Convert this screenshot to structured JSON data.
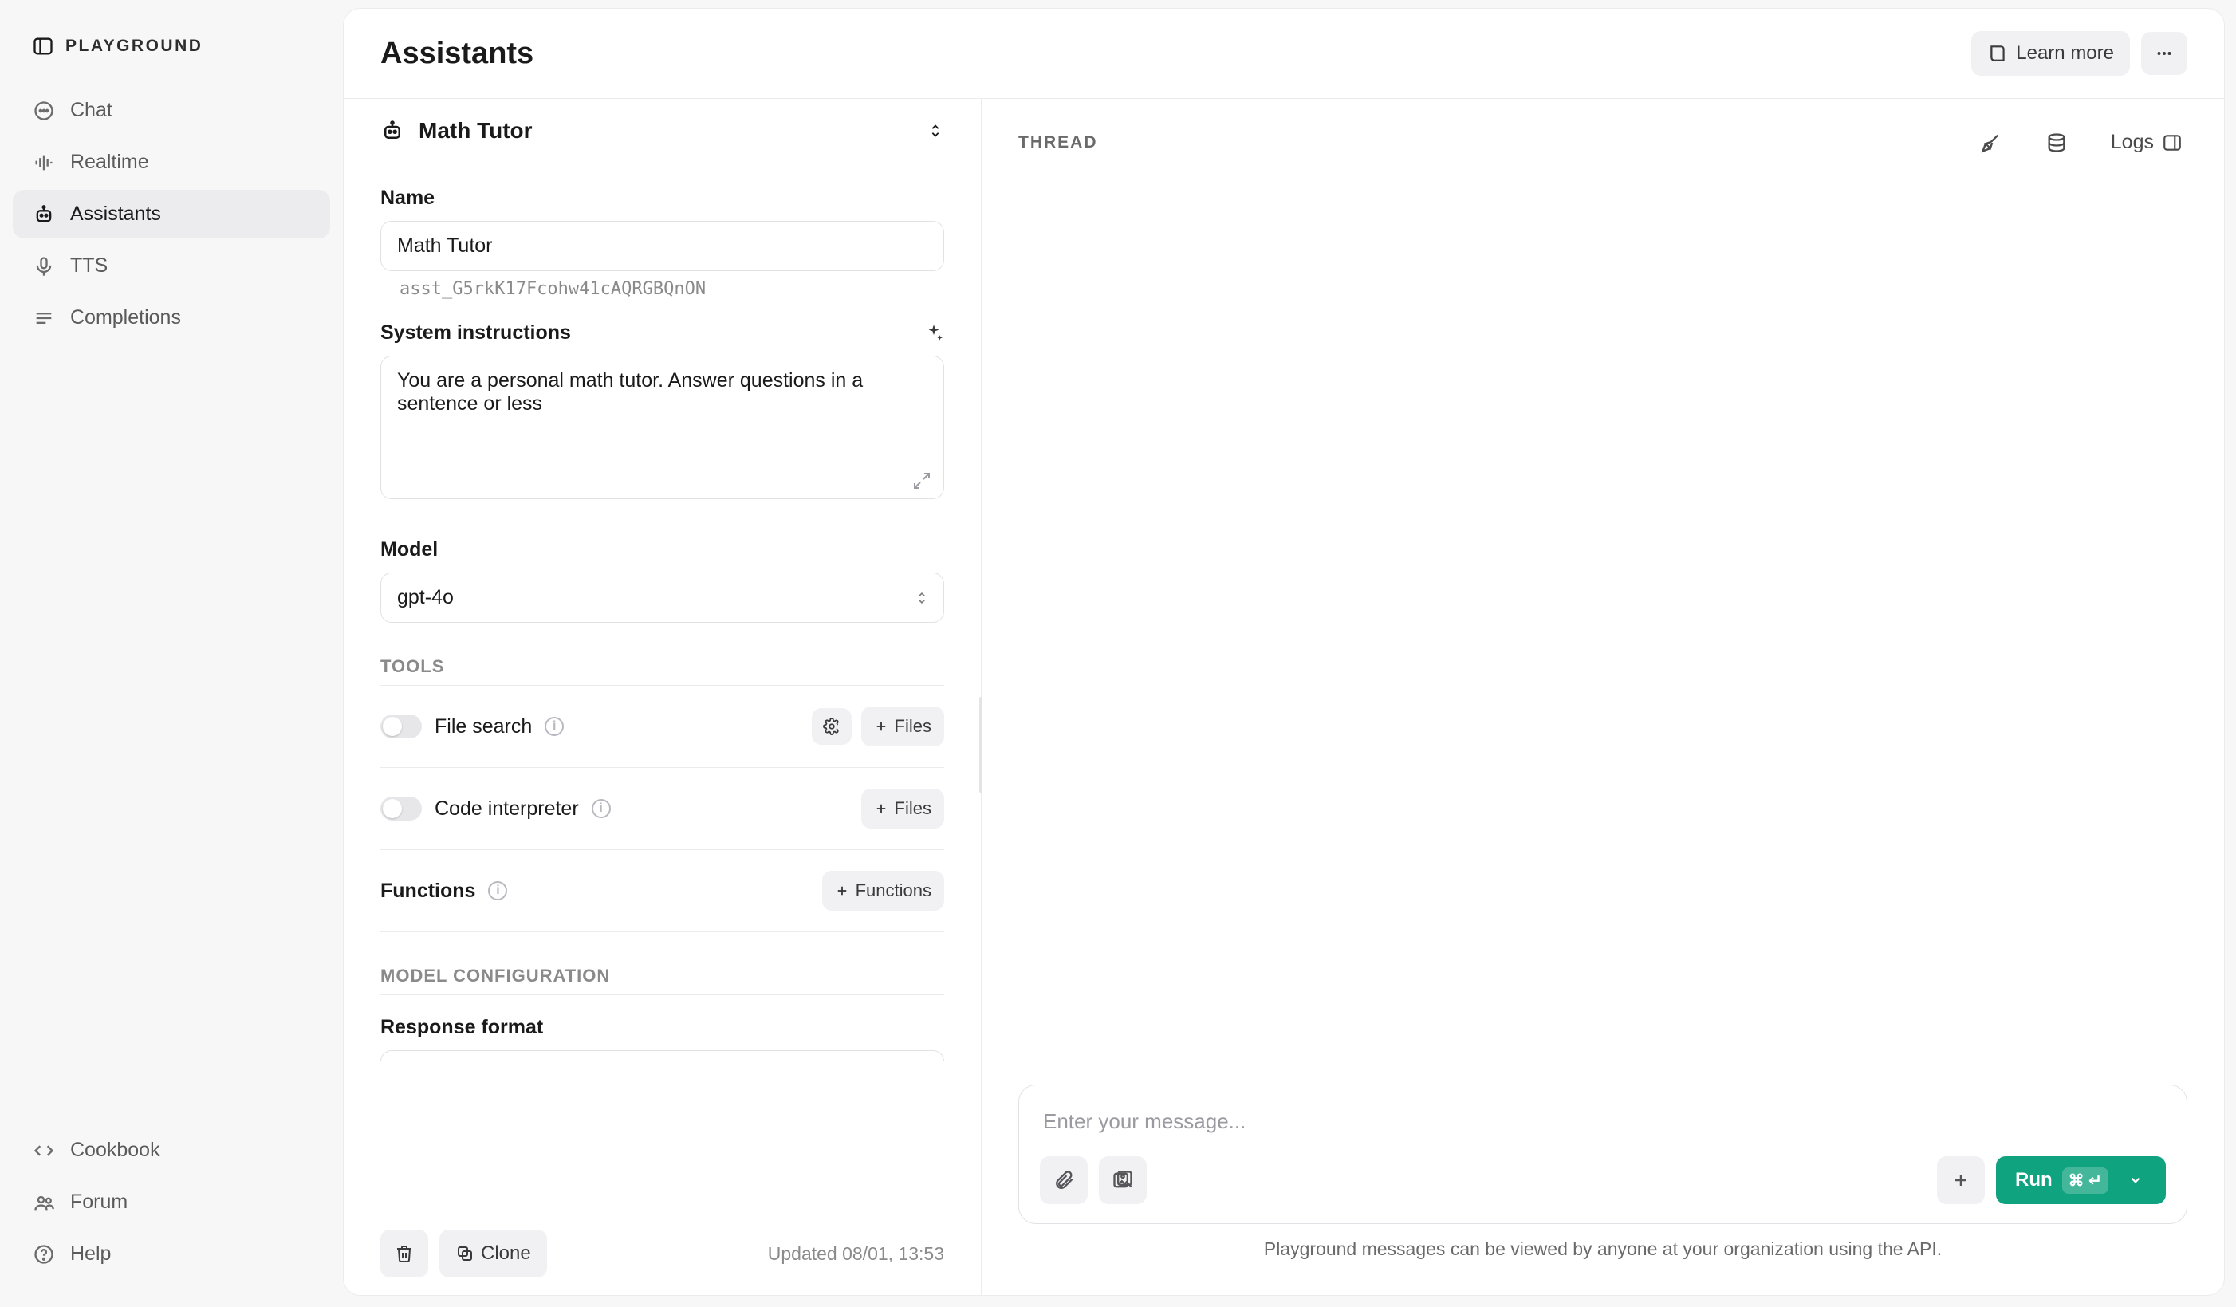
{
  "sidebar": {
    "brand": "PLAYGROUND",
    "nav": [
      {
        "label": "Chat"
      },
      {
        "label": "Realtime"
      },
      {
        "label": "Assistants"
      },
      {
        "label": "TTS"
      },
      {
        "label": "Completions"
      }
    ],
    "footer": [
      {
        "label": "Cookbook"
      },
      {
        "label": "Forum"
      },
      {
        "label": "Help"
      }
    ]
  },
  "header": {
    "title": "Assistants",
    "learn_more": "Learn more"
  },
  "config": {
    "selected_assistant": "Math Tutor",
    "name_label": "Name",
    "name_value": "Math Tutor",
    "assistant_id": "asst_G5rkK17Fcohw41cAQRGBQnON",
    "system_label": "System instructions",
    "system_value": "You are a personal math tutor. Answer questions in a sentence or less",
    "model_label": "Model",
    "model_value": "gpt-4o",
    "tools_heading": "TOOLS",
    "tool_file_search": "File search",
    "tool_code_interpreter": "Code interpreter",
    "tool_functions": "Functions",
    "files_btn": "Files",
    "functions_btn": "Functions",
    "model_config_heading": "MODEL CONFIGURATION",
    "response_format_label": "Response format",
    "clone_btn": "Clone",
    "updated_text": "Updated 08/01, 13:53"
  },
  "thread": {
    "heading": "THREAD",
    "logs_label": "Logs",
    "composer_placeholder": "Enter your message...",
    "run_label": "Run",
    "run_shortcut": "⌘ ↵",
    "footnote": "Playground messages can be viewed by anyone at your organization using the API."
  }
}
